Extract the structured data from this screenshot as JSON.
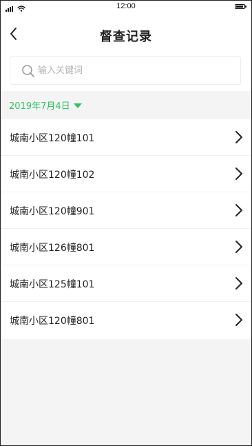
{
  "status_bar": {
    "time": "12:00",
    "icons": [
      "signal-icon",
      "wifi-icon",
      "battery-icon"
    ],
    "battery_level": 0.9
  },
  "header": {
    "title": "督查记录",
    "back_icon": "chevron-left-icon"
  },
  "search": {
    "placeholder": "输入关键词",
    "value": "",
    "icon": "search-icon"
  },
  "date_filter": {
    "label": "2019年7月4日",
    "icon": "caret-down-icon"
  },
  "records": [
    {
      "label": "城南小区120幢101"
    },
    {
      "label": "城南小区120幢102"
    },
    {
      "label": "城南小区120幢901"
    },
    {
      "label": "城南小区126幢801"
    },
    {
      "label": "城南小区125幢101"
    },
    {
      "label": "城南小区120幢801"
    }
  ],
  "colors": {
    "accent": "#33c166",
    "background": "#f4f4f4",
    "text": "#222222",
    "placeholder": "#b5b5b5"
  }
}
